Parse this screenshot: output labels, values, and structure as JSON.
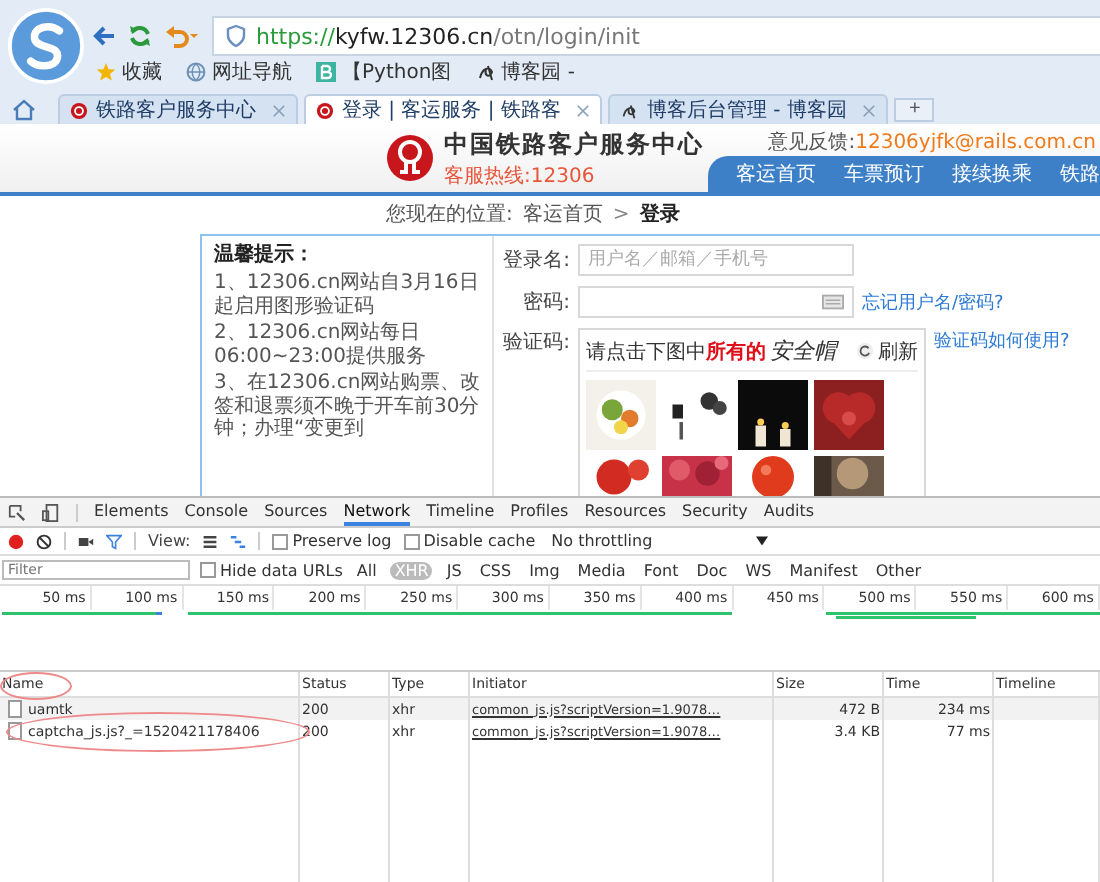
{
  "browser": {
    "scheme": "https://",
    "host": "kyfw.12306.cn",
    "path": "/otn/login/init",
    "bookmarks": [
      {
        "label": "收藏",
        "kind": "star"
      },
      {
        "label": "网址导航",
        "kind": "globe"
      },
      {
        "label": "【Python图",
        "kind": "b"
      },
      {
        "label": "博客园 -",
        "kind": "blog"
      }
    ],
    "tabs": [
      {
        "title": "铁路客户服务中心",
        "selected": false,
        "kind": "rail"
      },
      {
        "title": "登录 | 客运服务 | 铁路客",
        "selected": true,
        "kind": "rail"
      },
      {
        "title": "博客后台管理 - 博客园",
        "selected": false,
        "kind": "blog"
      }
    ],
    "new_tab": "+"
  },
  "header": {
    "title": "中国铁路客户服务中心",
    "hotline": "客服热线:12306",
    "feedback_label": "意见反馈:",
    "feedback_email": "12306yjfk@rails.com.cn",
    "nav": [
      "客运首页",
      "车票预订",
      "接续换乘",
      "铁路"
    ]
  },
  "breadcrumb": {
    "label": "您现在的位置:",
    "path": [
      "客运首页",
      "登录"
    ],
    "separator": ">"
  },
  "tips": {
    "title": "温馨提示：",
    "items": [
      "1、12306.cn网站自3月16日起启用图形验证码",
      "2、12306.cn网站每日06:00~23:00提供服务",
      "3、在12306.cn网站购票、改签和退票须不晚于开车前30分钟；办理“变更到"
    ]
  },
  "form": {
    "username": {
      "label": "登录名:",
      "placeholder": "用户名／邮箱／手机号"
    },
    "password": {
      "label": "密码:",
      "link": "忘记用户名/密码?"
    },
    "captcha": {
      "label": "验证码:",
      "link": "验证码如何使用?",
      "prompt": "请点击下图中",
      "highlight": "所有的",
      "target": "安全帽",
      "refresh": "刷新"
    }
  },
  "devtools": {
    "tabs": [
      {
        "label": "Elements",
        "selected": false
      },
      {
        "label": "Console",
        "selected": false
      },
      {
        "label": "Sources",
        "selected": false
      },
      {
        "label": "Network",
        "selected": true
      },
      {
        "label": "Timeline",
        "selected": false
      },
      {
        "label": "Profiles",
        "selected": false
      },
      {
        "label": "Resources",
        "selected": false
      },
      {
        "label": "Security",
        "selected": false
      },
      {
        "label": "Audits",
        "selected": false
      }
    ],
    "toolbar": {
      "recording": true,
      "view_label": "View:",
      "preserve_log": {
        "label": "Preserve log",
        "checked": false
      },
      "disable_cache": {
        "label": "Disable cache",
        "checked": false
      },
      "throttling": "No throttling"
    },
    "filter": {
      "placeholder": "Filter",
      "hide_data_urls": {
        "label": "Hide data URLs",
        "checked": false
      },
      "types": [
        {
          "label": "All",
          "selected": false
        },
        {
          "label": "XHR",
          "selected": true
        },
        {
          "label": "JS",
          "selected": false
        },
        {
          "label": "CSS",
          "selected": false
        },
        {
          "label": "Img",
          "selected": false
        },
        {
          "label": "Media",
          "selected": false
        },
        {
          "label": "Font",
          "selected": false
        },
        {
          "label": "Doc",
          "selected": false
        },
        {
          "label": "WS",
          "selected": false
        },
        {
          "label": "Manifest",
          "selected": false
        },
        {
          "label": "Other",
          "selected": false
        }
      ]
    },
    "overview": {
      "ticks": [
        "50 ms",
        "100 ms",
        "150 ms",
        "200 ms",
        "250 ms",
        "300 ms",
        "350 ms",
        "400 ms",
        "450 ms",
        "500 ms",
        "550 ms",
        "600 ms"
      ]
    },
    "table": {
      "columns": [
        "Name",
        "Status",
        "Type",
        "Initiator",
        "Size",
        "Time",
        "Timeline"
      ],
      "rows": [
        {
          "name": "uamtk",
          "status": "200",
          "type": "xhr",
          "initiator": "common_js.js?scriptVersion=1.9078…",
          "size": "472 B",
          "time": "234 ms"
        },
        {
          "name": "captcha_js.js?_=1520421178406",
          "status": "200",
          "type": "xhr",
          "initiator": "common_js.js?scriptVersion=1.9078…",
          "size": "3.4 KB",
          "time": "77 ms"
        }
      ]
    }
  }
}
